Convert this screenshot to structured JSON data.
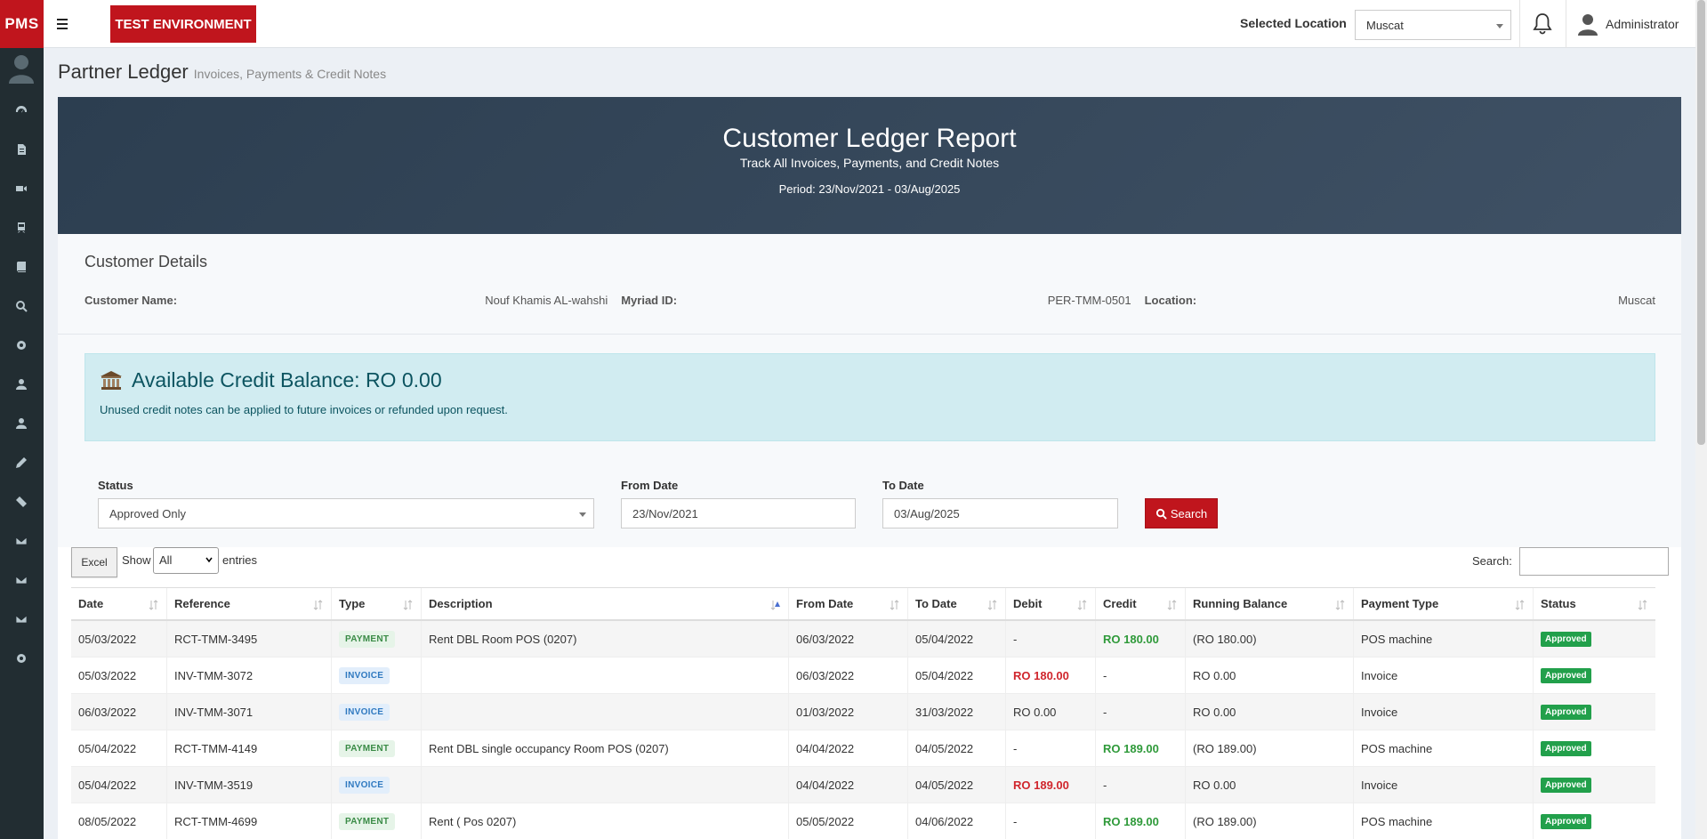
{
  "topbar": {
    "brand": "PMS",
    "environment": "TEST ENVIRONMENT",
    "location_label": "Selected Location",
    "location_value": "Muscat",
    "user_name": "Administrator"
  },
  "sidebar": {
    "icons": [
      "dashboard-icon",
      "document-icon",
      "video-icon",
      "train-icon",
      "book-icon",
      "search-icon",
      "gear-icon",
      "user-icon",
      "user-alt-icon",
      "pencil-icon",
      "ticket-icon",
      "envelope-icon",
      "envelope-alt-icon",
      "envelope-open-icon",
      "settings-icon"
    ]
  },
  "page": {
    "title": "Partner Ledger",
    "subtitle": "Invoices, Payments & Credit Notes"
  },
  "report": {
    "title": "Customer Ledger Report",
    "subtitle": "Track All Invoices, Payments, and Credit Notes",
    "period": "Period: 23/Nov/2021 - 03/Aug/2025"
  },
  "customer": {
    "heading": "Customer Details",
    "name_label": "Customer Name:",
    "name_value": "Nouf Khamis AL-wahshi",
    "id_label": "Myriad ID:",
    "id_value": "PER-TMM-0501",
    "location_label": "Location:",
    "location_value": "Muscat"
  },
  "credit": {
    "title": "Available Credit Balance: RO 0.00",
    "message": "Unused credit notes can be applied to future invoices or refunded upon request."
  },
  "filters": {
    "status_label": "Status",
    "status_value": "Approved Only",
    "from_label": "From Date",
    "from_value": "23/Nov/2021",
    "to_label": "To Date",
    "to_value": "03/Aug/2025",
    "search_button": "Search"
  },
  "table_controls": {
    "excel": "Excel",
    "show": "Show",
    "length_value": "All",
    "entries": "entries",
    "search_label": "Search:"
  },
  "table": {
    "columns": [
      "Date",
      "Reference",
      "Type",
      "Description",
      "From Date",
      "To Date",
      "Debit",
      "Credit",
      "Running Balance",
      "Payment Type",
      "Status"
    ],
    "rows": [
      {
        "date": "05/03/2022",
        "ref": "RCT-TMM-3495",
        "type": "PAYMENT",
        "desc": "Rent DBL Room POS (0207)",
        "from": "06/03/2022",
        "to": "05/04/2022",
        "debit": "-",
        "credit": "RO 180.00",
        "running": "(RO 180.00)",
        "ptype": "POS machine",
        "status": "Approved"
      },
      {
        "date": "05/03/2022",
        "ref": "INV-TMM-3072",
        "type": "INVOICE",
        "desc": "",
        "from": "06/03/2022",
        "to": "05/04/2022",
        "debit": "RO 180.00",
        "credit": "-",
        "running": "RO 0.00",
        "ptype": "Invoice",
        "status": "Approved"
      },
      {
        "date": "06/03/2022",
        "ref": "INV-TMM-3071",
        "type": "INVOICE",
        "desc": "",
        "from": "01/03/2022",
        "to": "31/03/2022",
        "debit": "RO 0.00",
        "credit": "-",
        "running": "RO 0.00",
        "ptype": "Invoice",
        "status": "Approved"
      },
      {
        "date": "05/04/2022",
        "ref": "RCT-TMM-4149",
        "type": "PAYMENT",
        "desc": "Rent DBL single occupancy Room POS (0207)",
        "from": "04/04/2022",
        "to": "04/05/2022",
        "debit": "-",
        "credit": "RO 189.00",
        "running": "(RO 189.00)",
        "ptype": "POS machine",
        "status": "Approved"
      },
      {
        "date": "05/04/2022",
        "ref": "INV-TMM-3519",
        "type": "INVOICE",
        "desc": "",
        "from": "04/04/2022",
        "to": "04/05/2022",
        "debit": "RO 189.00",
        "credit": "-",
        "running": "RO 0.00",
        "ptype": "Invoice",
        "status": "Approved"
      },
      {
        "date": "08/05/2022",
        "ref": "RCT-TMM-4699",
        "type": "PAYMENT",
        "desc": "Rent ( Pos 0207)",
        "from": "05/05/2022",
        "to": "04/06/2022",
        "debit": "-",
        "credit": "RO 189.00",
        "running": "(RO 189.00)",
        "ptype": "POS machine",
        "status": "Approved"
      }
    ]
  },
  "colors": {
    "brand_red": "#c0151d",
    "sidebar_bg": "#222d32",
    "hero_bg": "#2c3e50",
    "credit_bg": "#d1ecf1",
    "approved_green": "#22a04b"
  }
}
